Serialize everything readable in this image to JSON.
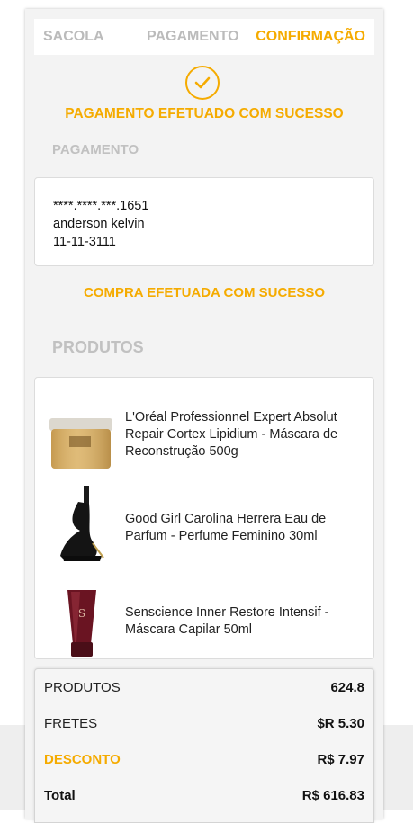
{
  "steps": {
    "bag": "SACOLA",
    "payment": "PAGAMENTO",
    "confirmation": "CONFIRMAÇÃO"
  },
  "status": {
    "icon": "check-circle-icon",
    "message": "PAGAMENTO EFETUADO COM SUCESSO"
  },
  "payment": {
    "section_label": "PAGAMENTO",
    "card_number": "****.****.***.1651",
    "holder": "anderson kelvin",
    "expiry": "11-11-3111"
  },
  "order_status": "COMPRA EFETUADA COM SUCESSO",
  "products": {
    "section_label": "PRODUTOS",
    "items": [
      {
        "name": "L'Oréal Professionnel Expert Absolut Repair Cortex Lipidium - Máscara de Reconstrução 500g",
        "icon": "hair-mask-jar-image"
      },
      {
        "name": "Good Girl Carolina Herrera Eau de Parfum - Perfume Feminino 30ml",
        "icon": "perfume-bottle-image"
      },
      {
        "name": "Senscience Inner Restore Intensif - Máscara Capilar 50ml",
        "icon": "hair-mask-tube-image"
      }
    ]
  },
  "summary": {
    "products_label": "PRODUTOS",
    "products_value": "624.8",
    "shipping_label": "FRETES",
    "shipping_value": "$R 5.30",
    "discount_label": "DESCONTO",
    "discount_value": "R$ 7.97",
    "total_label": "Total",
    "total_value": "R$ 616.83"
  },
  "colors": {
    "accent": "#f5ab00",
    "muted": "#bbbbbb",
    "panel": "#f3f3f3"
  }
}
